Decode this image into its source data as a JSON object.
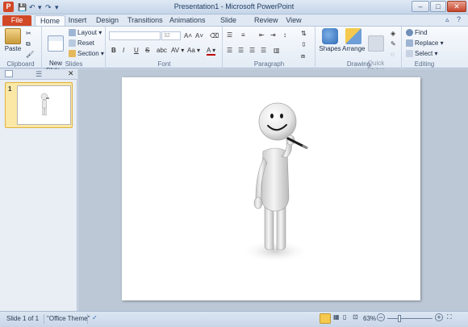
{
  "app": {
    "icon_letter": "P",
    "title": "Presentation1 - Microsoft PowerPoint",
    "window_buttons": {
      "minimize": "–",
      "maximize": "□",
      "close": "✕"
    },
    "qat": {
      "save": "💾",
      "undo": "↶",
      "redo": "↷",
      "more": "▾"
    }
  },
  "tabs": [
    "File",
    "Home",
    "Insert",
    "Design",
    "Transitions",
    "Animations",
    "Slide Show",
    "Review",
    "View"
  ],
  "ribbon_controls": {
    "collapse": "▵",
    "help": "?"
  },
  "ribbon": {
    "clipboard": {
      "paste": "Paste",
      "label": "Clipboard"
    },
    "slides": {
      "new_slide": "New\nSlide ▾",
      "layout": "Layout ▾",
      "reset": "Reset",
      "section": "Section ▾",
      "label": "Slides"
    },
    "font": {
      "label": "Font",
      "size_placeholder": "32",
      "grow": "A˄",
      "shrink": "A˅",
      "clear": "⌫",
      "bold": "B",
      "italic": "I",
      "underline": "U",
      "strike": "S",
      "shadow": "abc",
      "spacing": "AV ▾",
      "case": "Aa ▾",
      "color": "A ▾"
    },
    "paragraph": {
      "label": "Paragraph"
    },
    "drawing": {
      "shapes": "Shapes",
      "arrange": "Arrange",
      "quick_styles": "Quick\nStyles ▾",
      "label": "Drawing"
    },
    "editing": {
      "find": "Find",
      "replace": "Replace ▾",
      "select": "Select ▾",
      "label": "Editing"
    }
  },
  "slides_pane": {
    "slide_number": "1",
    "close": "✕"
  },
  "status": {
    "slide": "Slide 1 of 1",
    "theme": "\"Office Theme\"",
    "zoom": "63%",
    "zoom_minus": "−",
    "zoom_plus": "+"
  }
}
